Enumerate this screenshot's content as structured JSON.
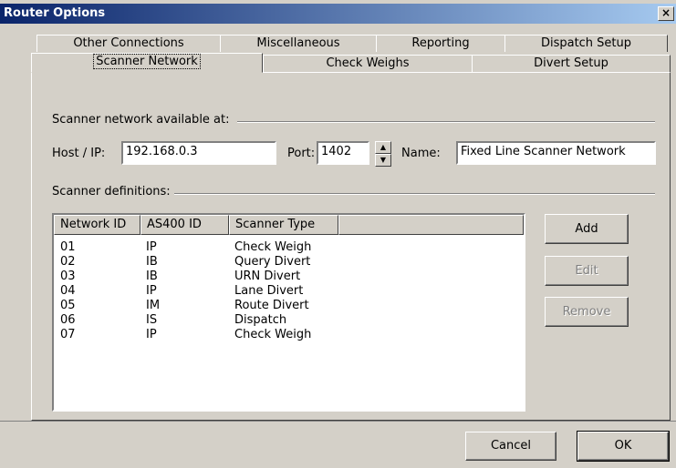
{
  "window": {
    "title": "Router Options",
    "close_glyph": "×"
  },
  "tabs_back": [
    "Other Connections",
    "Miscellaneous",
    "Reporting",
    "Dispatch Setup"
  ],
  "tabs_front": [
    "Scanner Network",
    "Check Weighs",
    "Divert Setup"
  ],
  "active_tab": "Scanner Network",
  "network": {
    "group_label": "Scanner network available at:",
    "host_label": "Host / IP:",
    "host_value": "192.168.0.3",
    "port_label": "Port:",
    "port_value": "1402",
    "name_label": "Name:",
    "name_value": "Fixed Line Scanner Network"
  },
  "definitions": {
    "group_label": "Scanner definitions:",
    "columns": [
      "Network ID",
      "AS400 ID",
      "Scanner Type"
    ],
    "rows": [
      [
        "01",
        "IP",
        "Check Weigh"
      ],
      [
        "02",
        "IB",
        "Query Divert"
      ],
      [
        "03",
        "IB",
        "URN Divert"
      ],
      [
        "04",
        "IP",
        "Lane Divert"
      ],
      [
        "05",
        "IM",
        "Route Divert"
      ],
      [
        "06",
        "IS",
        "Dispatch"
      ],
      [
        "07",
        "IP",
        "Check Weigh"
      ]
    ]
  },
  "buttons": {
    "add": "Add",
    "edit": "Edit",
    "remove": "Remove",
    "cancel": "Cancel",
    "ok": "OK"
  }
}
